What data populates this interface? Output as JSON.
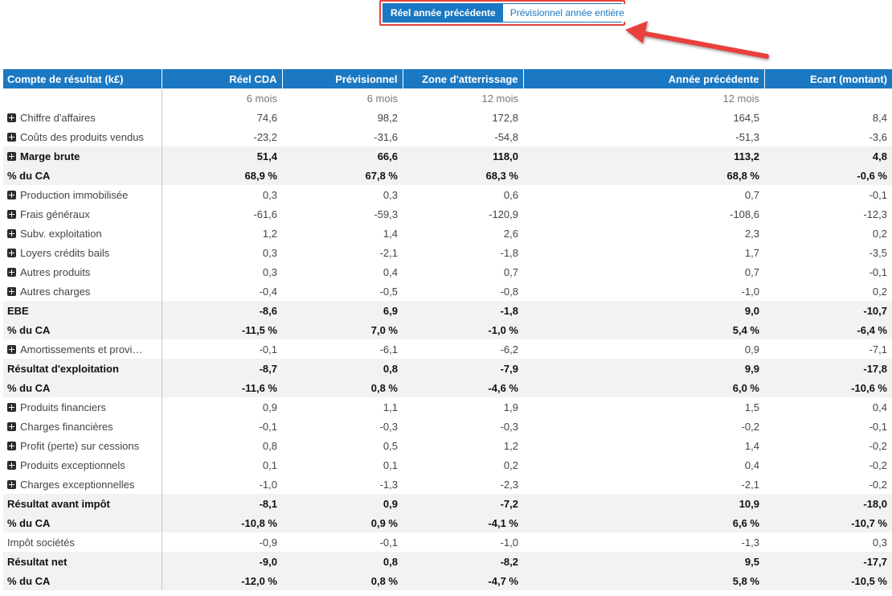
{
  "toggle": {
    "active_label": "Réel année précédente",
    "inactive_label": "Prévisionnel année entière"
  },
  "colors": {
    "accent": "#1b78c2",
    "highlight": "#e8413b"
  },
  "table": {
    "headers": [
      "Compte de résultat (k£)",
      "Réel CDA",
      "Prévisionnel",
      "Zone d'atterrissage",
      "Année précédente",
      "Ecart (montant)"
    ],
    "subheader": [
      "",
      "6 mois",
      "6 mois",
      "12 mois",
      "12 mois",
      ""
    ],
    "rows": [
      {
        "label": "Chiffre d'affaires",
        "expandable": true,
        "bold": false,
        "values": [
          "74,6",
          "98,2",
          "172,8",
          "164,5",
          "8,4"
        ]
      },
      {
        "label": "Coûts des produits vendus",
        "expandable": true,
        "bold": false,
        "values": [
          "-23,2",
          "-31,6",
          "-54,8",
          "-51,3",
          "-3,6"
        ]
      },
      {
        "label": "Marge brute",
        "expandable": true,
        "bold": true,
        "values": [
          "51,4",
          "66,6",
          "118,0",
          "113,2",
          "4,8"
        ]
      },
      {
        "label": "% du CA",
        "expandable": false,
        "bold": true,
        "values": [
          "68,9 %",
          "67,8 %",
          "68,3 %",
          "68,8 %",
          "-0,6 %"
        ]
      },
      {
        "label": "Production immobilisée",
        "expandable": true,
        "bold": false,
        "values": [
          "0,3",
          "0,3",
          "0,6",
          "0,7",
          "-0,1"
        ]
      },
      {
        "label": "Frais généraux",
        "expandable": true,
        "bold": false,
        "values": [
          "-61,6",
          "-59,3",
          "-120,9",
          "-108,6",
          "-12,3"
        ]
      },
      {
        "label": "Subv. exploitation",
        "expandable": true,
        "bold": false,
        "values": [
          "1,2",
          "1,4",
          "2,6",
          "2,3",
          "0,2"
        ]
      },
      {
        "label": "Loyers crédits bails",
        "expandable": true,
        "bold": false,
        "values": [
          "0,3",
          "-2,1",
          "-1,8",
          "1,7",
          "-3,5"
        ]
      },
      {
        "label": "Autres produits",
        "expandable": true,
        "bold": false,
        "values": [
          "0,3",
          "0,4",
          "0,7",
          "0,7",
          "-0,1"
        ]
      },
      {
        "label": "Autres charges",
        "expandable": true,
        "bold": false,
        "values": [
          "-0,4",
          "-0,5",
          "-0,8",
          "-1,0",
          "0,2"
        ]
      },
      {
        "label": "EBE",
        "expandable": false,
        "bold": true,
        "values": [
          "-8,6",
          "6,9",
          "-1,8",
          "9,0",
          "-10,7"
        ]
      },
      {
        "label": "% du CA",
        "expandable": false,
        "bold": true,
        "values": [
          "-11,5 %",
          "7,0 %",
          "-1,0 %",
          "5,4 %",
          "-6,4 %"
        ]
      },
      {
        "label": "Amortissements et provi…",
        "expandable": true,
        "bold": false,
        "values": [
          "-0,1",
          "-6,1",
          "-6,2",
          "0,9",
          "-7,1"
        ]
      },
      {
        "label": "Résultat d'exploitation",
        "expandable": false,
        "bold": true,
        "values": [
          "-8,7",
          "0,8",
          "-7,9",
          "9,9",
          "-17,8"
        ]
      },
      {
        "label": "% du CA",
        "expandable": false,
        "bold": true,
        "values": [
          "-11,6 %",
          "0,8 %",
          "-4,6 %",
          "6,0 %",
          "-10,6 %"
        ]
      },
      {
        "label": "Produits financiers",
        "expandable": true,
        "bold": false,
        "values": [
          "0,9",
          "1,1",
          "1,9",
          "1,5",
          "0,4"
        ]
      },
      {
        "label": "Charges financières",
        "expandable": true,
        "bold": false,
        "values": [
          "-0,1",
          "-0,3",
          "-0,3",
          "-0,2",
          "-0,1"
        ]
      },
      {
        "label": "Profit (perte) sur cessions",
        "expandable": true,
        "bold": false,
        "values": [
          "0,8",
          "0,5",
          "1,2",
          "1,4",
          "-0,2"
        ]
      },
      {
        "label": "Produits exceptionnels",
        "expandable": true,
        "bold": false,
        "values": [
          "0,1",
          "0,1",
          "0,2",
          "0,4",
          "-0,2"
        ]
      },
      {
        "label": "Charges exceptionnelles",
        "expandable": true,
        "bold": false,
        "values": [
          "-1,0",
          "-1,3",
          "-2,3",
          "-2,1",
          "-0,2"
        ]
      },
      {
        "label": "Résultat avant impôt",
        "expandable": false,
        "bold": true,
        "values": [
          "-8,1",
          "0,9",
          "-7,2",
          "10,9",
          "-18,0"
        ]
      },
      {
        "label": "% du CA",
        "expandable": false,
        "bold": true,
        "values": [
          "-10,8 %",
          "0,9 %",
          "-4,1 %",
          "6,6 %",
          "-10,7 %"
        ]
      },
      {
        "label": "Impôt sociétés",
        "expandable": false,
        "bold": false,
        "values": [
          "-0,9",
          "-0,1",
          "-1,0",
          "-1,3",
          "0,3"
        ]
      },
      {
        "label": "Résultat net",
        "expandable": false,
        "bold": true,
        "values": [
          "-9,0",
          "0,8",
          "-8,2",
          "9,5",
          "-17,7"
        ]
      },
      {
        "label": "% du CA",
        "expandable": false,
        "bold": true,
        "values": [
          "-12,0 %",
          "0,8 %",
          "-4,7 %",
          "5,8 %",
          "-10,5 %"
        ]
      }
    ]
  }
}
